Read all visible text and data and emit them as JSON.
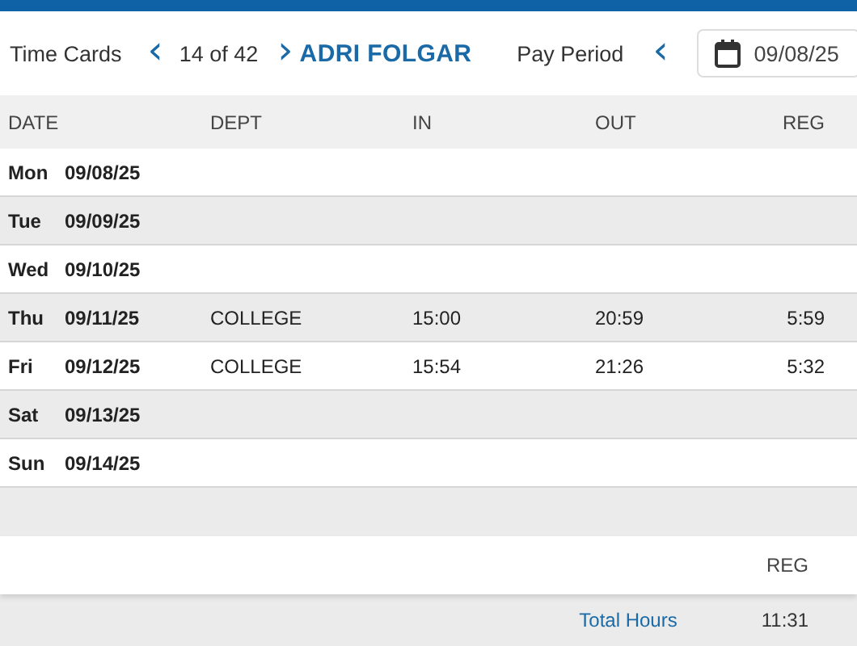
{
  "header": {
    "title": "Time Cards",
    "prev_label": "‹",
    "position": "14 of 42",
    "next_label": "›",
    "employee": "ADRI FOLGAR",
    "period_label": "Pay Period",
    "period_prev": "‹",
    "period_date": "09/08/25"
  },
  "table": {
    "columns": [
      "DATE",
      "DEPT",
      "IN",
      "OUT",
      "REG"
    ],
    "rows": [
      {
        "day": "Mon",
        "date": "09/08/25",
        "dept": "",
        "in": "",
        "out": "",
        "reg": ""
      },
      {
        "day": "Tue",
        "date": "09/09/25",
        "dept": "",
        "in": "",
        "out": "",
        "reg": ""
      },
      {
        "day": "Wed",
        "date": "09/10/25",
        "dept": "",
        "in": "",
        "out": "",
        "reg": ""
      },
      {
        "day": "Thu",
        "date": "09/11/25",
        "dept": "COLLEGE",
        "in": "15:00",
        "out": "20:59",
        "reg": "5:59"
      },
      {
        "day": "Fri",
        "date": "09/12/25",
        "dept": "COLLEGE",
        "in": "15:54",
        "out": "21:26",
        "reg": "5:32"
      },
      {
        "day": "Sat",
        "date": "09/13/25",
        "dept": "",
        "in": "",
        "out": "",
        "reg": ""
      },
      {
        "day": "Sun",
        "date": "09/14/25",
        "dept": "",
        "in": "",
        "out": "",
        "reg": ""
      }
    ]
  },
  "totals": {
    "column": "REG",
    "label": "Total Hours",
    "value": "11:31"
  }
}
